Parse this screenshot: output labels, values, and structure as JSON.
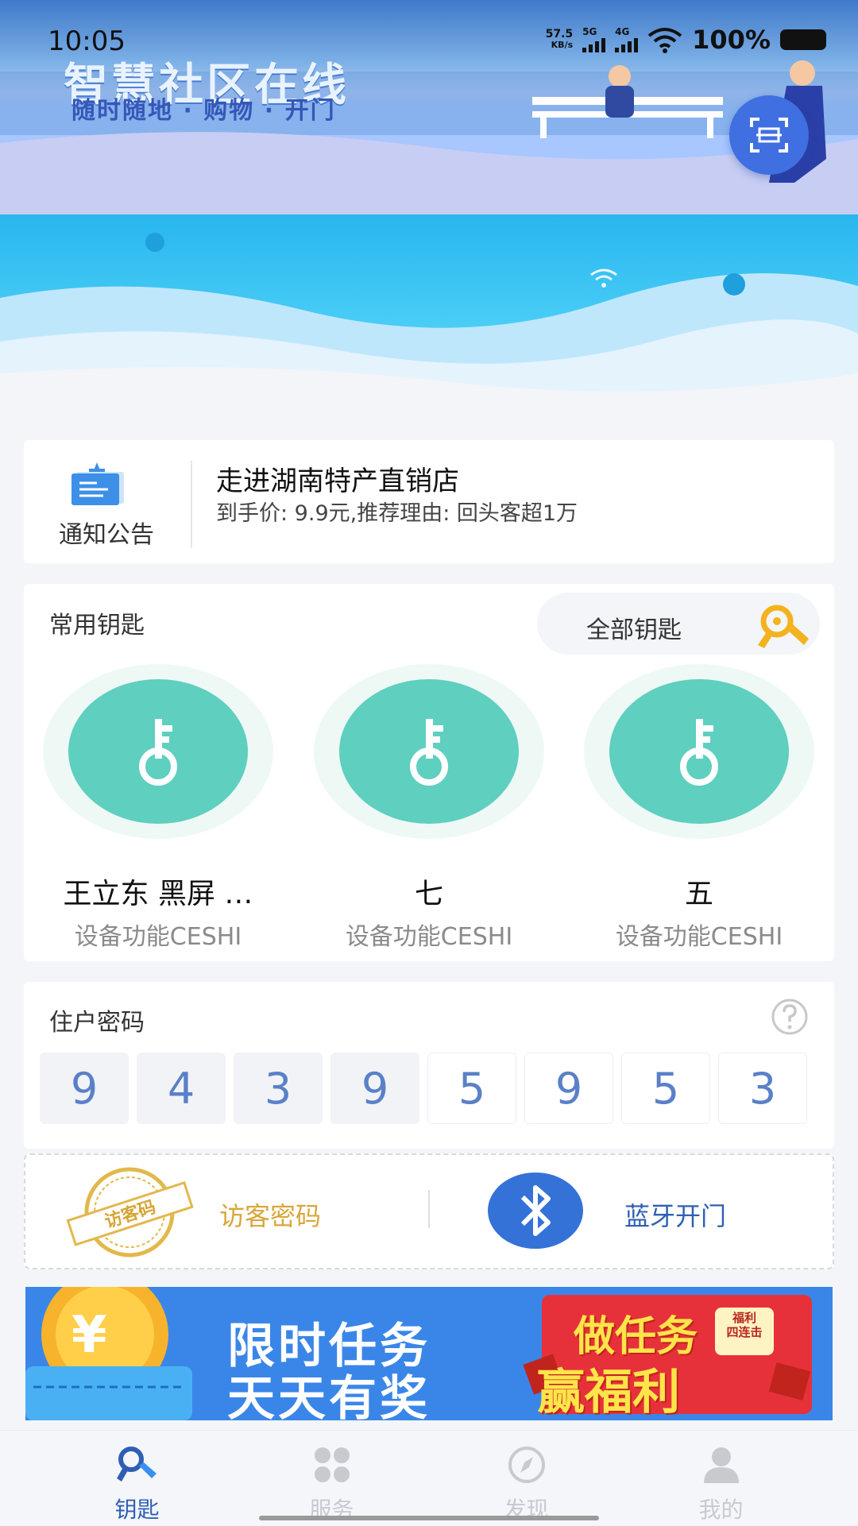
{
  "status_bar": {
    "time": "10:05",
    "net_speed_value": "57.5",
    "net_speed_unit": "KB/s",
    "sim1": "5G",
    "sim2": "4G",
    "battery": "100%"
  },
  "hero": {
    "banner_title": "智慧社区在线",
    "banner_subtitle": "随时随地 · 购物 · 开门",
    "scan_icon": "scan-icon",
    "wifi_icon": "wifi-icon"
  },
  "notice": {
    "label": "通知公告",
    "title": "走进湖南特产直销店",
    "desc": "到手价: 9.9元,推荐理由: 回头客超1万"
  },
  "keys": {
    "title": "常用钥匙",
    "all_keys_label": "全部钥匙",
    "items": [
      {
        "name": "王立东 黑屏 …",
        "sub": "设备功能CESHI"
      },
      {
        "name": "七",
        "sub": "设备功能CESHI"
      },
      {
        "name": "五",
        "sub": "设备功能CESHI"
      }
    ]
  },
  "password": {
    "title": "住户密码",
    "digits": [
      "9",
      "4",
      "3",
      "9",
      "5",
      "9",
      "5",
      "3"
    ]
  },
  "actions": {
    "visitor_stamp_text": "访客码",
    "visitor_label": "访客密码",
    "bluetooth_label": "蓝牙开门"
  },
  "promo": {
    "line1": "限时任务",
    "line2": "天天有奖",
    "right_line1": "做任务",
    "right_line2": "赢福利",
    "badge_line1": "福利",
    "badge_line2": "四连击"
  },
  "tabs": [
    {
      "label": "钥匙",
      "icon": "key-icon",
      "active": true
    },
    {
      "label": "服务",
      "icon": "grid-icon",
      "active": false
    },
    {
      "label": "发现",
      "icon": "compass-icon",
      "active": false
    },
    {
      "label": "我的",
      "icon": "user-icon",
      "active": false
    }
  ],
  "colors": {
    "accent": "#3f6fe0",
    "key_green": "#5fcfbf",
    "digit_blue": "#5a80c8",
    "visitor_gold": "#d8a63a",
    "tab_active": "#2f5fb4",
    "tab_inactive": "#c8cad0"
  }
}
